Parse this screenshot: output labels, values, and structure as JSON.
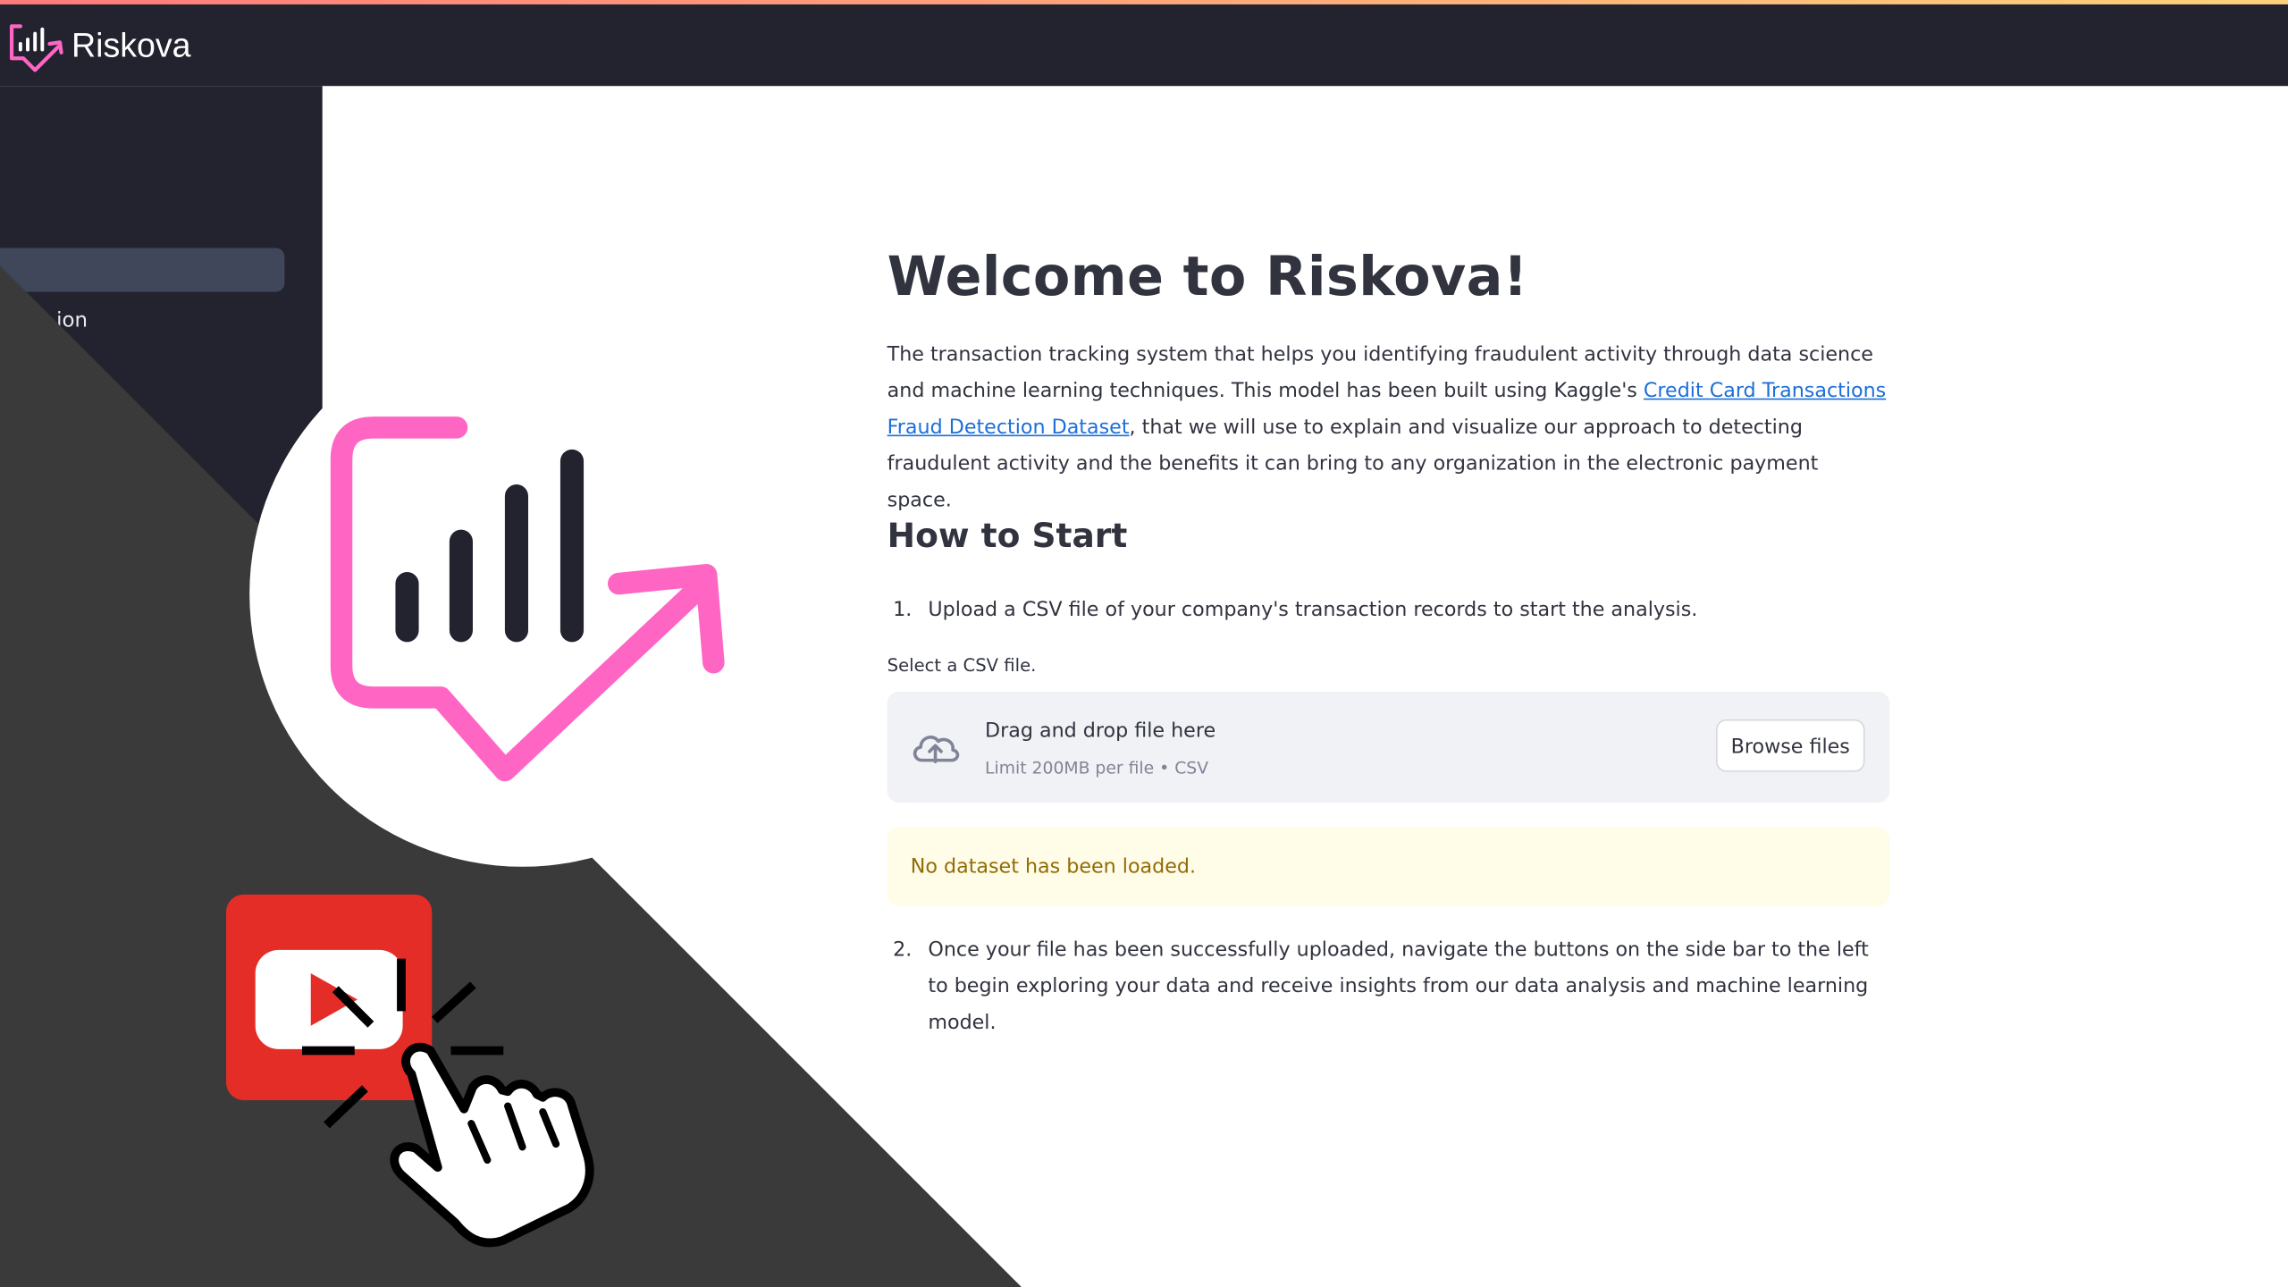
{
  "header": {
    "brand_name": "Riskova",
    "logo_icon": "riskova-logo-icon",
    "accent_pink": "#ff66c4",
    "bar_color": "#22232f"
  },
  "sidebar": {
    "partial_label": "ion"
  },
  "main": {
    "title": "Welcome to Riskova!",
    "intro_before_link": "The transaction tracking system that helps you identifying fraudulent activity through data science and machine learning techniques. This model has been built using Kaggle's ",
    "intro_link": "Credit Card Transactions Fraud Detection Dataset",
    "intro_after_link": ", that we will use to explain and visualize our approach to detecting fraudulent activity and the benefits it can bring to any organization in the electronic payment space.",
    "how_to_title": "How to Start",
    "steps": [
      {
        "num": "1.",
        "text": "Upload a CSV file of your company's transaction records to start the analysis."
      },
      {
        "num": "2.",
        "text": "Once your file has been successfully uploaded, navigate the buttons on the side bar to the left to begin exploring your data and receive insights from our data analysis and machine learning model."
      }
    ]
  },
  "uploader": {
    "label": "Select a CSV file.",
    "drop_title": "Drag and drop file here",
    "limit": "Limit 200MB per file • CSV",
    "browse_label": "Browse files",
    "icon": "cloud-upload-icon"
  },
  "alert": {
    "text": "No dataset has been loaded.",
    "bg_color": "#fffce7",
    "text_color": "#926c05"
  },
  "overlay": {
    "big_logo_icon": "riskova-logo-icon",
    "youtube_icon": "youtube-play-icon",
    "cursor_icon": "pointing-hand-cursor-icon",
    "youtube_color": "#e52d27",
    "dark_panel_color": "#3a3a3a"
  }
}
